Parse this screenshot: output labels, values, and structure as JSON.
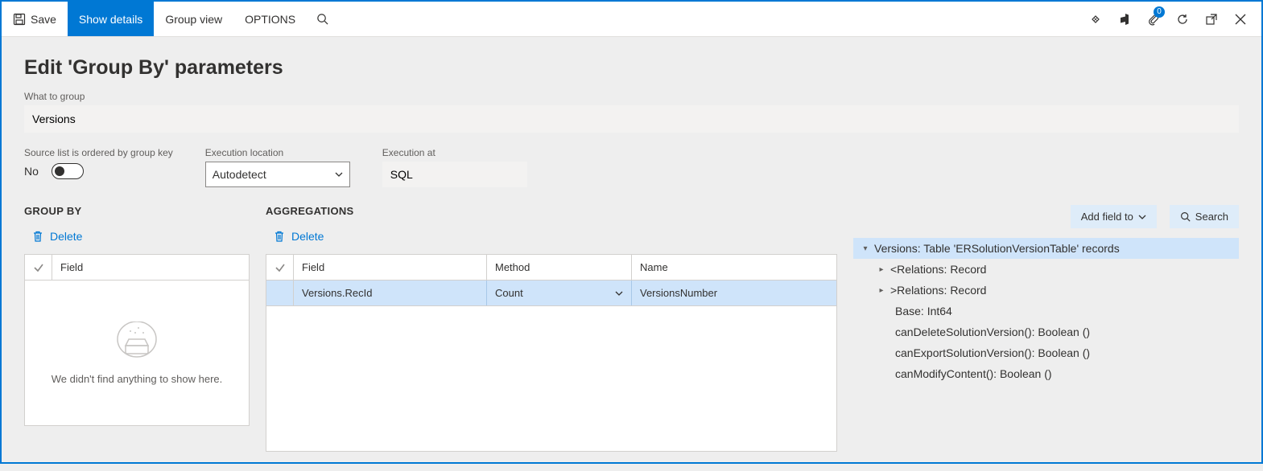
{
  "toolbar": {
    "save_label": "Save",
    "show_details_label": "Show details",
    "group_view_label": "Group view",
    "options_label": "OPTIONS",
    "attach_badge": "0"
  },
  "page": {
    "title": "Edit 'Group By' parameters",
    "what_to_group_label": "What to group",
    "what_to_group_value": "Versions",
    "ordered_label": "Source list is ordered by group key",
    "ordered_value": "No",
    "exec_location_label": "Execution location",
    "exec_location_value": "Autodetect",
    "exec_at_label": "Execution at",
    "exec_at_value": "SQL"
  },
  "groupby": {
    "heading": "GROUP BY",
    "delete_label": "Delete",
    "col_field": "Field",
    "empty_msg": "We didn't find anything to show here."
  },
  "aggregations": {
    "heading": "AGGREGATIONS",
    "delete_label": "Delete",
    "col_field": "Field",
    "col_method": "Method",
    "col_name": "Name",
    "row0_field": "Versions.RecId",
    "row0_method": "Count",
    "row0_name": "VersionsNumber"
  },
  "tree": {
    "add_field_to_label": "Add field to",
    "search_label": "Search",
    "root": "Versions: Table 'ERSolutionVersionTable' records",
    "less_relations": "<Relations: Record",
    "more_relations": ">Relations: Record",
    "base": "Base: Int64",
    "can_delete": "canDeleteSolutionVersion(): Boolean ()",
    "can_export": "canExportSolutionVersion(): Boolean ()",
    "can_modify": "canModifyContent(): Boolean ()"
  }
}
